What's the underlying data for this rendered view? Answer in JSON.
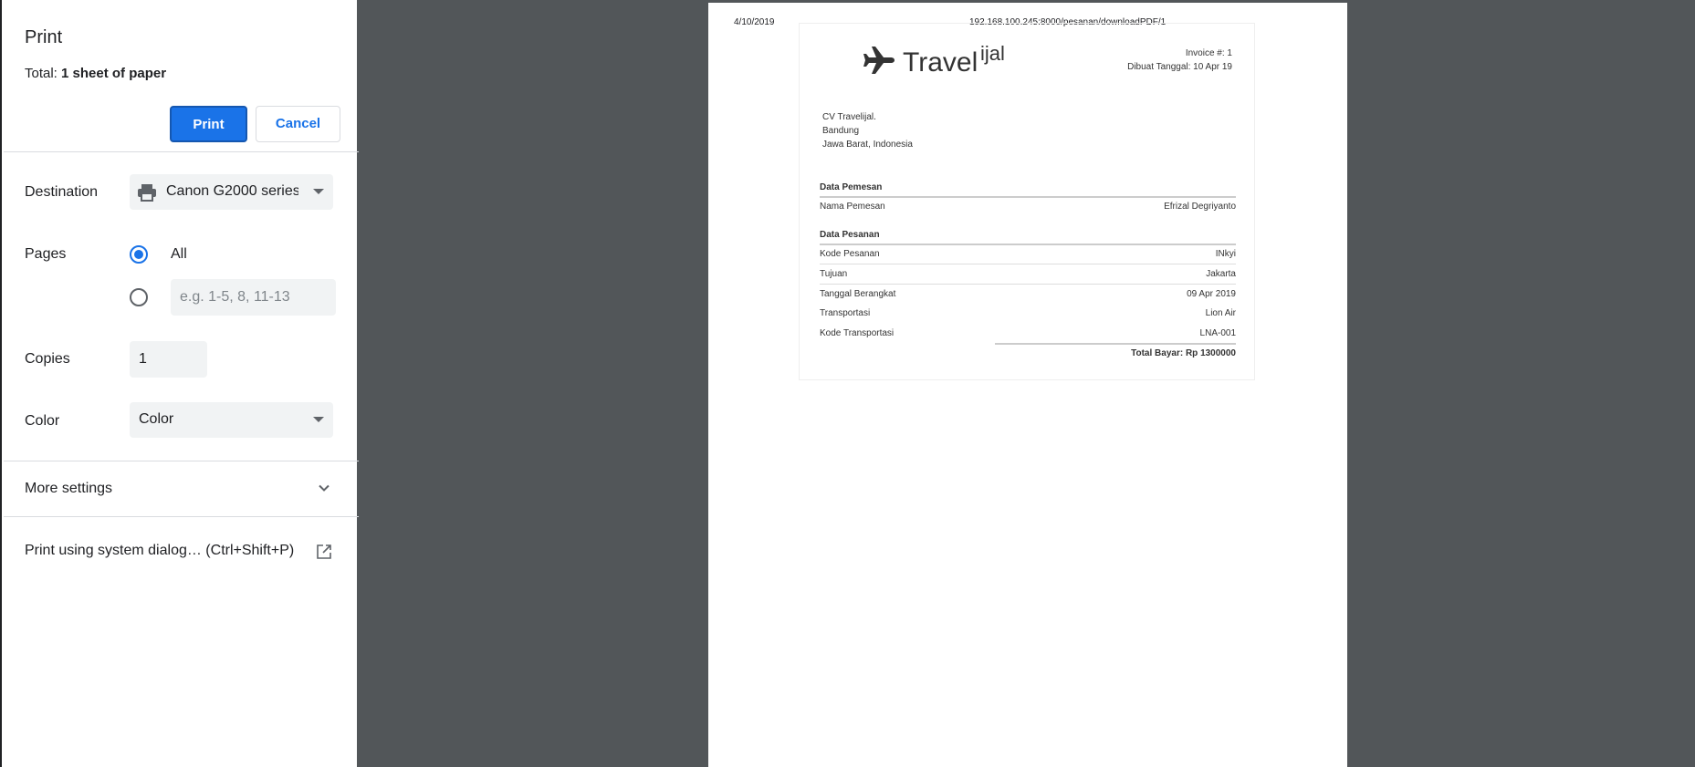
{
  "panel": {
    "title": "Print",
    "total_prefix": "Total:",
    "total_value": "1 sheet of paper",
    "print_label": "Print",
    "cancel_label": "Cancel",
    "destination": {
      "label": "Destination",
      "value": "Canon G2000 series"
    },
    "pages": {
      "label": "Pages",
      "all_label": "All",
      "selected": "All",
      "range_placeholder": "e.g. 1-5, 8, 11-13"
    },
    "copies": {
      "label": "Copies",
      "value": "1"
    },
    "color": {
      "label": "Color",
      "value": "Color"
    },
    "more_settings_label": "More settings",
    "system_dialog_label": "Print using system dialog… (Ctrl+Shift+P)"
  },
  "preview": {
    "header_date": "4/10/2019",
    "header_url": "192.168.100.245:8000/pesanan/downloadPDF/1",
    "invoice": {
      "brand": "Travel",
      "brand_sup": "ijal",
      "invoice_no": "Invoice #: 1",
      "created": "Dibuat Tanggal: 10 Apr 19",
      "address": [
        "CV Travelijal.",
        "Bandung",
        "Jawa Barat, Indonesia"
      ],
      "section1_title": "Data Pemesan",
      "section1_rows": [
        {
          "key": "Nama Pemesan",
          "value": "Efrizal Degriyanto"
        }
      ],
      "section2_title": "Data Pesanan",
      "section2_rows": [
        {
          "key": "Kode Pesanan",
          "value": "INkyi"
        },
        {
          "key": "Tujuan",
          "value": "Jakarta"
        },
        {
          "key": "Tanggal Berangkat",
          "value": "09 Apr 2019"
        },
        {
          "key": "Transportasi",
          "value": "Lion Air"
        },
        {
          "key": "Kode Transportasi",
          "value": "LNA-001"
        }
      ],
      "total": "Total Bayar: Rp 1300000"
    }
  },
  "colors": {
    "accent": "#1a73e8",
    "viewer_bg": "#525659"
  },
  "icons": [
    "printer-icon",
    "chevron-down-icon",
    "open-in-new-icon",
    "airplane-icon"
  ]
}
